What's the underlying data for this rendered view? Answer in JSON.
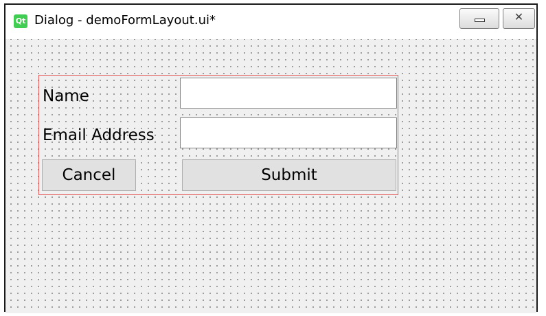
{
  "window": {
    "title": "Dialog - demoFormLayout.ui*",
    "app_icon_text": "Qt",
    "minimize_glyph": "",
    "close_glyph": "✕"
  },
  "form": {
    "name_label": "Name",
    "name_value": "",
    "email_label": "Email Address",
    "email_value": "",
    "cancel_label": "Cancel",
    "submit_label": "Submit"
  }
}
